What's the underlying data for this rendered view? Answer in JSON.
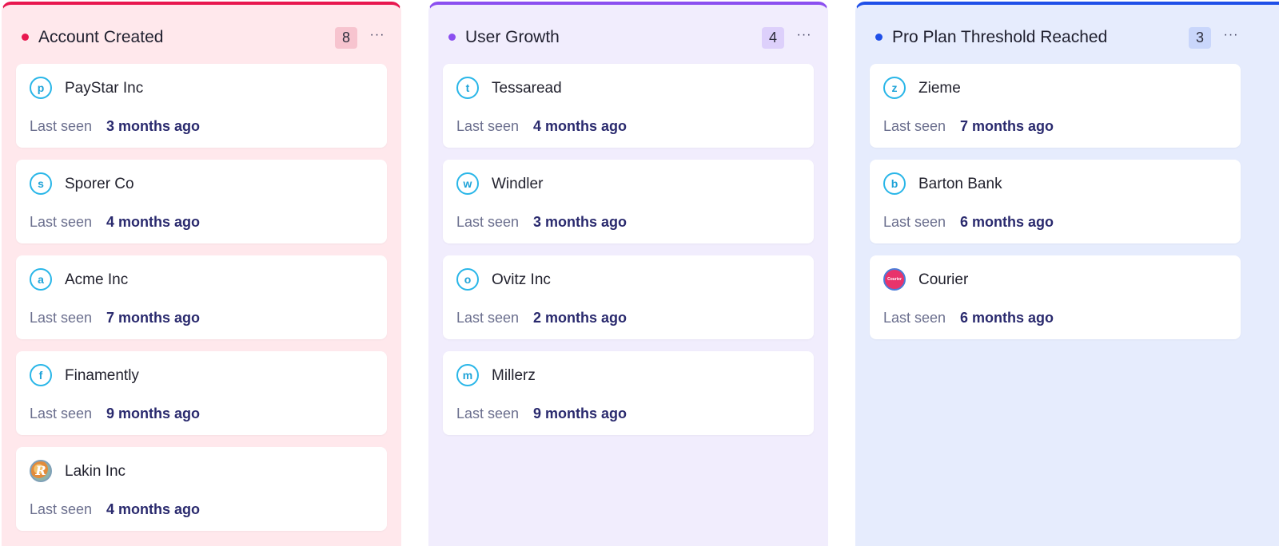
{
  "board": {
    "columns": [
      {
        "title": "Account Created",
        "count": "8",
        "menu": "···",
        "accent_color": "#e8174f",
        "background_color": "#ffe8ec",
        "count_background": "#f7c4cf",
        "cards": [
          {
            "avatar": "p",
            "name": "PayStar Inc",
            "seen_label": "Last seen",
            "seen_value": "3 months ago"
          },
          {
            "avatar": "s",
            "name": "Sporer Co",
            "seen_label": "Last seen",
            "seen_value": "4 months ago"
          },
          {
            "avatar": "a",
            "name": "Acme Inc",
            "seen_label": "Last seen",
            "seen_value": "7 months ago"
          },
          {
            "avatar": "f",
            "name": "Finamently",
            "seen_label": "Last seen",
            "seen_value": "9 months ago"
          },
          {
            "avatar": "R",
            "avatar_icon": "lakin-logo-icon",
            "name": "Lakin Inc",
            "seen_label": "Last seen",
            "seen_value": "4 months ago"
          }
        ]
      },
      {
        "title": "User Growth",
        "count": "4",
        "menu": "···",
        "accent_color": "#8b4ff0",
        "background_color": "#f1edfd",
        "count_background": "#ddd0fb",
        "cards": [
          {
            "avatar": "t",
            "name": "Tessaread",
            "seen_label": "Last seen",
            "seen_value": "4 months ago"
          },
          {
            "avatar": "w",
            "name": "Windler",
            "seen_label": "Last seen",
            "seen_value": "3 months ago"
          },
          {
            "avatar": "o",
            "name": "Ovitz Inc",
            "seen_label": "Last seen",
            "seen_value": "2 months ago"
          },
          {
            "avatar": "m",
            "name": "Millerz",
            "seen_label": "Last seen",
            "seen_value": "9 months ago"
          }
        ]
      },
      {
        "title": "Pro Plan Threshold Reached",
        "count": "3",
        "menu": "···",
        "accent_color": "#1f4fe8",
        "background_color": "#e6ecfd",
        "count_background": "#c9d6fb",
        "cards": [
          {
            "avatar": "z",
            "name": "Zieme",
            "seen_label": "Last seen",
            "seen_value": "7 months ago"
          },
          {
            "avatar": "b",
            "name": "Barton Bank",
            "seen_label": "Last seen",
            "seen_value": "6 months ago"
          },
          {
            "avatar": "Courier",
            "avatar_icon": "courier-logo-icon",
            "name": "Courier",
            "seen_label": "Last seen",
            "seen_value": "6 months ago"
          }
        ]
      }
    ]
  }
}
